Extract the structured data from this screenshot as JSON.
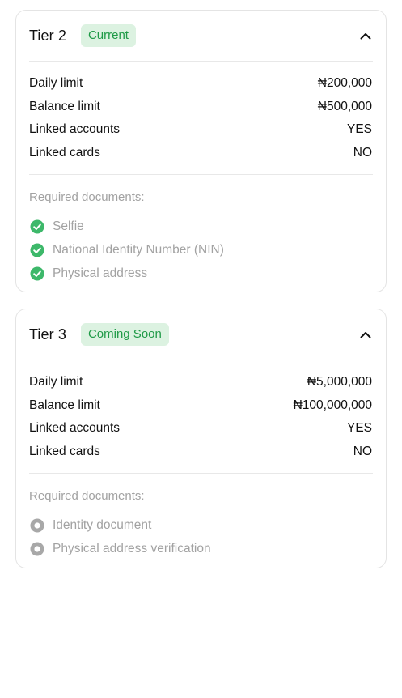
{
  "colors": {
    "badge_bg": "#dcf2e1",
    "badge_text": "#1f9a47",
    "check_green": "#3db86a",
    "pending_grey": "#a8a8a8",
    "muted_text": "#a2a2a2"
  },
  "tiers": [
    {
      "title": "Tier 2",
      "badge": "Current",
      "expanded": true,
      "chevron_icon": "chevron-up-icon",
      "limits": [
        {
          "label": "Daily limit",
          "value": "₦200,000"
        },
        {
          "label": "Balance limit",
          "value": "₦500,000"
        },
        {
          "label": "Linked accounts",
          "value": "YES"
        },
        {
          "label": "Linked cards",
          "value": "NO"
        }
      ],
      "documents_heading": "Required documents:",
      "documents": [
        {
          "label": "Selfie",
          "status": "completed",
          "icon": "check-circle-icon"
        },
        {
          "label": "National Identity Number (NIN)",
          "status": "completed",
          "icon": "check-circle-icon"
        },
        {
          "label": "Physical address",
          "status": "completed",
          "icon": "check-circle-icon"
        }
      ]
    },
    {
      "title": "Tier 3",
      "badge": "Coming Soon",
      "expanded": true,
      "chevron_icon": "chevron-up-icon",
      "limits": [
        {
          "label": "Daily limit",
          "value": "₦5,000,000"
        },
        {
          "label": "Balance limit",
          "value": "₦100,000,000"
        },
        {
          "label": "Linked accounts",
          "value": "YES"
        },
        {
          "label": "Linked cards",
          "value": "NO"
        }
      ],
      "documents_heading": "Required documents:",
      "documents": [
        {
          "label": "Identity document",
          "status": "pending",
          "icon": "radio-dot-icon"
        },
        {
          "label": "Physical address verification",
          "status": "pending",
          "icon": "radio-dot-icon"
        }
      ]
    }
  ]
}
